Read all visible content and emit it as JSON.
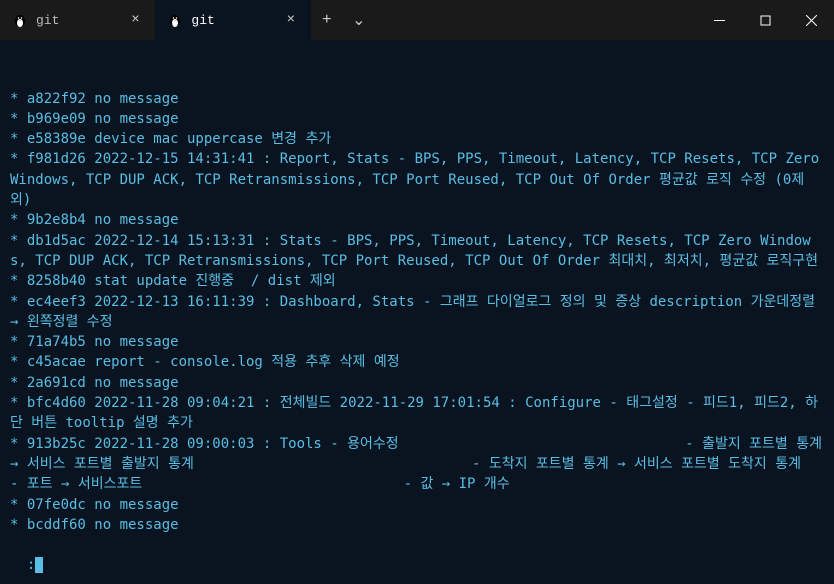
{
  "titlebar": {
    "tabs": [
      {
        "title": "git",
        "active": false
      },
      {
        "title": "git",
        "active": true
      }
    ],
    "newTabLabel": "+",
    "dropdownLabel": "⌄"
  },
  "terminal": {
    "lines": [
      "* a822f92 no message",
      "* b969e09 no message",
      "* e58389e device mac uppercase 변경 추가",
      "* f981d26 2022-12-15 14:31:41 : Report, Stats - BPS, PPS, Timeout, Latency, TCP Resets, TCP Zero Windows, TCP DUP ACK, TCP Retransmissions, TCP Port Reused, TCP Out Of Order 평균값 로직 수정 (0제외)",
      "* 9b2e8b4 no message",
      "* db1d5ac 2022-12-14 15:13:31 : Stats - BPS, PPS, Timeout, Latency, TCP Resets, TCP Zero Windows, TCP DUP ACK, TCP Retransmissions, TCP Port Reused, TCP Out Of Order 최대치, 최저치, 평균값 로직구현",
      "* 8258b40 stat update 진행중  / dist 제외",
      "* ec4eef3 2022-12-13 16:11:39 : Dashboard, Stats - 그래프 다이얼로그 정의 및 증상 description 가운데정렬 → 왼쪽정렬 수정",
      "* 71a74b5 no message",
      "* c45acae report - console.log 적용 추후 삭제 예정",
      "* 2a691cd no message",
      "* bfc4d60 2022-11-28 09:04:21 : 전체빌드 2022-11-29 17:01:54 : Configure - 태그설정 - 피드1, 피드2, 하단 버튼 tooltip 설명 추가",
      "* 913b25c 2022-11-28 09:00:03 : Tools - 용어수정                                  - 출발지 포트별 통계 → 서비스 포트별 출발지 통계                                 - 도착지 포트별 통계 → 서비스 포트별 도착지 통계                                 - 포트 → 서비스포트                               - 값 → IP 개수",
      "* 07fe0dc no message",
      "* bcddf60 no message"
    ],
    "prompt": ":"
  }
}
